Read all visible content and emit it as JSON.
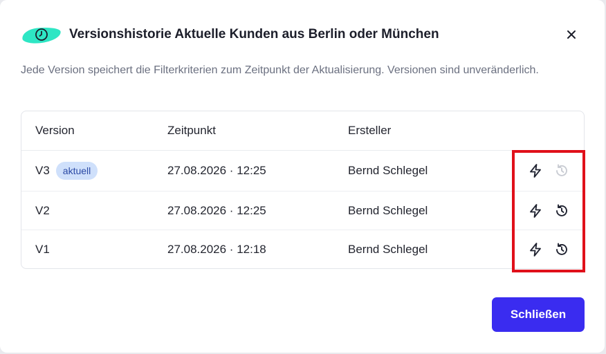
{
  "dialog": {
    "title": "Versionshistorie Aktuelle Kunden aus Berlin oder München",
    "description": "Jede Version speichert die Filterkriterien zum Zeitpunkt der Aktualisierung. Versionen sind unveränderlich.",
    "header_icon": "clock-icon",
    "accent_color": "#2ee6c4",
    "close_icon": "close-icon"
  },
  "table": {
    "columns": [
      "Version",
      "Zeitpunkt",
      "Ersteller"
    ],
    "rows": [
      {
        "version": "V3",
        "badge": "aktuell",
        "timestamp": "27.08.2026 · 12:25",
        "creator": "Bernd Schlegel",
        "restore_enabled": false
      },
      {
        "version": "V2",
        "badge": "",
        "timestamp": "27.08.2026 · 12:25",
        "creator": "Bernd Schlegel",
        "restore_enabled": true
      },
      {
        "version": "V1",
        "badge": "",
        "timestamp": "27.08.2026 · 12:18",
        "creator": "Bernd Schlegel",
        "restore_enabled": true
      }
    ],
    "action_icons": [
      "lightning-icon",
      "history-restore-icon"
    ]
  },
  "footer": {
    "close_label": "Schließen",
    "button_color": "#3a2cf0"
  },
  "highlight_color": "#e0101a"
}
